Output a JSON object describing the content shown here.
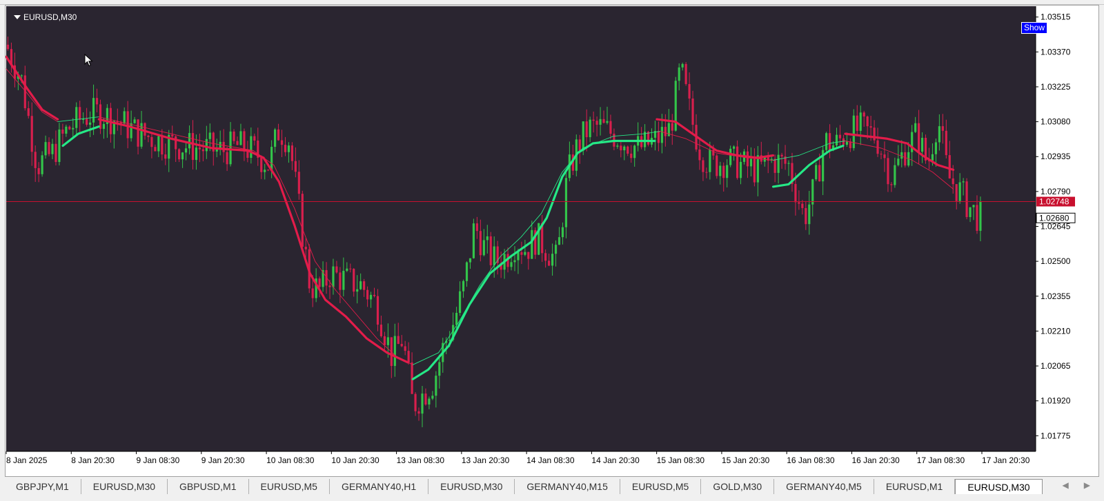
{
  "window": {
    "title": "EURUSD,M30",
    "show_button": "Show"
  },
  "colors": {
    "background": "#2a2530",
    "bull": "#33c44a",
    "bear": "#d81f4d",
    "ma_up": "#25e886",
    "ma_down": "#e31c4a",
    "price_line": "#c8102e",
    "axis_text": "#ffffff",
    "tab_active_bg": "#ffffff"
  },
  "chart_data": {
    "type": "candlestick",
    "symbol": "EURUSD",
    "timeframe": "M30",
    "ylim": [
      1.0171,
      1.0356
    ],
    "y_ticks": [
      "1.03515",
      "1.03370",
      "1.03225",
      "1.03080",
      "1.02935",
      "1.02790",
      "1.02645",
      "1.02500",
      "1.02355",
      "1.02210",
      "1.02065",
      "1.01920",
      "1.01775"
    ],
    "x_ticks": [
      "8 Jan 2025",
      "8 Jan 20:30",
      "9 Jan 08:30",
      "9 Jan 20:30",
      "10 Jan 08:30",
      "10 Jan 20:30",
      "13 Jan 08:30",
      "13 Jan 20:30",
      "14 Jan 08:30",
      "14 Jan 20:30",
      "15 Jan 08:30",
      "15 Jan 20:30",
      "16 Jan 08:30",
      "16 Jan 20:30",
      "17 Jan 08:30",
      "17 Jan 20:30"
    ],
    "current_price": "1.02748",
    "last_price": "1.02680",
    "close_path": [
      [
        0,
        1.034
      ],
      [
        0.015,
        1.0325
      ],
      [
        0.03,
        1.029
      ],
      [
        0.045,
        1.0295
      ],
      [
        0.06,
        1.0305
      ],
      [
        0.075,
        1.031
      ],
      [
        0.09,
        1.0312
      ],
      [
        0.11,
        1.0308
      ],
      [
        0.13,
        1.0303
      ],
      [
        0.15,
        1.03
      ],
      [
        0.17,
        1.0298
      ],
      [
        0.19,
        1.0297
      ],
      [
        0.21,
        1.0296
      ],
      [
        0.225,
        1.0298
      ],
      [
        0.24,
        1.0296
      ],
      [
        0.255,
        1.029
      ],
      [
        0.265,
        1.0305
      ],
      [
        0.275,
        1.03
      ],
      [
        0.285,
        1.027
      ],
      [
        0.295,
        1.024
      ],
      [
        0.305,
        1.0238
      ],
      [
        0.315,
        1.0245
      ],
      [
        0.33,
        1.0242
      ],
      [
        0.345,
        1.024
      ],
      [
        0.36,
        1.0232
      ],
      [
        0.375,
        1.021
      ],
      [
        0.385,
        1.0218
      ],
      [
        0.395,
        1.019
      ],
      [
        0.405,
        1.0195
      ],
      [
        0.415,
        1.02
      ],
      [
        0.425,
        1.0215
      ],
      [
        0.435,
        1.0225
      ],
      [
        0.445,
        1.024
      ],
      [
        0.455,
        1.0265
      ],
      [
        0.465,
        1.0255
      ],
      [
        0.475,
        1.025
      ],
      [
        0.485,
        1.0252
      ],
      [
        0.495,
        1.0258
      ],
      [
        0.505,
        1.0255
      ],
      [
        0.515,
        1.026
      ],
      [
        0.525,
        1.0255
      ],
      [
        0.535,
        1.025
      ],
      [
        0.545,
        1.0285
      ],
      [
        0.555,
        1.0298
      ],
      [
        0.565,
        1.0305
      ],
      [
        0.575,
        1.0306
      ],
      [
        0.585,
        1.0304
      ],
      [
        0.6,
        1.03
      ],
      [
        0.615,
        1.0297
      ],
      [
        0.63,
        1.03
      ],
      [
        0.645,
        1.0305
      ],
      [
        0.655,
        1.033
      ],
      [
        0.665,
        1.031
      ],
      [
        0.675,
        1.0295
      ],
      [
        0.685,
        1.029
      ],
      [
        0.7,
        1.0292
      ],
      [
        0.715,
        1.029
      ],
      [
        0.73,
        1.0288
      ],
      [
        0.745,
        1.0292
      ],
      [
        0.76,
        1.029
      ],
      [
        0.775,
        1.0268
      ],
      [
        0.785,
        1.028
      ],
      [
        0.795,
        1.03
      ],
      [
        0.805,
        1.0298
      ],
      [
        0.815,
        1.0303
      ],
      [
        0.83,
        1.0305
      ],
      [
        0.845,
        1.0302
      ],
      [
        0.86,
        1.0285
      ],
      [
        0.875,
        1.0298
      ],
      [
        0.885,
        1.0303
      ],
      [
        0.895,
        1.029
      ],
      [
        0.905,
        1.031
      ],
      [
        0.915,
        1.0285
      ],
      [
        0.925,
        1.028
      ],
      [
        0.935,
        1.0273
      ],
      [
        0.945,
        1.0268
      ]
    ],
    "ma_fast": [
      {
        "color": "bear",
        "points": [
          [
            0,
            1.0335
          ],
          [
            0.02,
            1.0322
          ],
          [
            0.035,
            1.0313
          ],
          [
            0.05,
            1.0309
          ]
        ]
      },
      {
        "color": "bull",
        "points": [
          [
            0.055,
            1.0298
          ],
          [
            0.07,
            1.0303
          ],
          [
            0.09,
            1.0306
          ]
        ]
      },
      {
        "color": "bear",
        "points": [
          [
            0.09,
            1.0309
          ],
          [
            0.12,
            1.0306
          ],
          [
            0.16,
            1.0301
          ],
          [
            0.2,
            1.0297
          ],
          [
            0.235,
            1.0296
          ],
          [
            0.25,
            1.0293
          ],
          [
            0.265,
            1.0283
          ],
          [
            0.28,
            1.0265
          ],
          [
            0.295,
            1.0245
          ],
          [
            0.31,
            1.0234
          ],
          [
            0.33,
            1.0227
          ],
          [
            0.35,
            1.0218
          ],
          [
            0.37,
            1.0212
          ],
          [
            0.39,
            1.0208
          ]
        ]
      },
      {
        "color": "bull",
        "points": [
          [
            0.395,
            1.0201
          ],
          [
            0.41,
            1.0205
          ],
          [
            0.43,
            1.0215
          ],
          [
            0.45,
            1.0232
          ],
          [
            0.47,
            1.0245
          ],
          [
            0.49,
            1.0252
          ],
          [
            0.51,
            1.0258
          ],
          [
            0.525,
            1.0268
          ],
          [
            0.54,
            1.0285
          ],
          [
            0.555,
            1.0295
          ],
          [
            0.57,
            1.0299
          ],
          [
            0.59,
            1.03
          ],
          [
            0.61,
            1.03
          ],
          [
            0.63,
            1.03
          ]
        ]
      },
      {
        "color": "bear",
        "points": [
          [
            0.632,
            1.0309
          ],
          [
            0.65,
            1.0308
          ],
          [
            0.67,
            1.0302
          ],
          [
            0.69,
            1.0296
          ],
          [
            0.71,
            1.0294
          ],
          [
            0.73,
            1.0293
          ],
          [
            0.745,
            1.0294
          ]
        ]
      },
      {
        "color": "bull",
        "points": [
          [
            0.745,
            1.0281
          ],
          [
            0.76,
            1.0282
          ],
          [
            0.78,
            1.029
          ],
          [
            0.8,
            1.0296
          ],
          [
            0.813,
            1.0298
          ]
        ]
      },
      {
        "color": "bear",
        "points": [
          [
            0.815,
            1.0303
          ],
          [
            0.835,
            1.0302
          ],
          [
            0.855,
            1.0301
          ],
          [
            0.875,
            1.0299
          ],
          [
            0.89,
            1.0294
          ],
          [
            0.905,
            1.029
          ],
          [
            0.92,
            1.0288
          ]
        ]
      }
    ],
    "ma_slow": [
      {
        "color": "bear",
        "points": [
          [
            0,
            1.033
          ],
          [
            0.02,
            1.032
          ],
          [
            0.035,
            1.0312
          ],
          [
            0.05,
            1.0308
          ]
        ]
      },
      {
        "color": "bull",
        "points": [
          [
            0.05,
            1.0308
          ],
          [
            0.07,
            1.0309
          ],
          [
            0.09,
            1.031
          ]
        ]
      },
      {
        "color": "bear",
        "points": [
          [
            0.09,
            1.031
          ],
          [
            0.14,
            1.0305
          ],
          [
            0.2,
            1.0299
          ],
          [
            0.24,
            1.0296
          ],
          [
            0.26,
            1.029
          ],
          [
            0.28,
            1.0272
          ],
          [
            0.3,
            1.025
          ],
          [
            0.32,
            1.0238
          ],
          [
            0.34,
            1.0228
          ],
          [
            0.36,
            1.0218
          ],
          [
            0.38,
            1.021
          ],
          [
            0.395,
            1.0207
          ]
        ]
      },
      {
        "color": "bull",
        "points": [
          [
            0.395,
            1.0207
          ],
          [
            0.42,
            1.0212
          ],
          [
            0.44,
            1.0225
          ],
          [
            0.46,
            1.024
          ],
          [
            0.48,
            1.0252
          ],
          [
            0.5,
            1.026
          ],
          [
            0.52,
            1.027
          ],
          [
            0.54,
            1.0287
          ],
          [
            0.56,
            1.0297
          ],
          [
            0.59,
            1.0302
          ],
          [
            0.62,
            1.0303
          ],
          [
            0.635,
            1.0304
          ]
        ]
      },
      {
        "color": "bear",
        "points": [
          [
            0.635,
            1.0304
          ],
          [
            0.66,
            1.0301
          ],
          [
            0.69,
            1.0295
          ],
          [
            0.72,
            1.0293
          ],
          [
            0.745,
            1.0292
          ]
        ]
      },
      {
        "color": "bull",
        "points": [
          [
            0.745,
            1.0292
          ],
          [
            0.77,
            1.0294
          ],
          [
            0.8,
            1.0299
          ],
          [
            0.815,
            1.03
          ]
        ]
      },
      {
        "color": "bear",
        "points": [
          [
            0.815,
            1.03
          ],
          [
            0.85,
            1.0297
          ],
          [
            0.88,
            1.0292
          ],
          [
            0.9,
            1.0287
          ],
          [
            0.92,
            1.028
          ]
        ]
      }
    ]
  },
  "tabs": [
    {
      "label": "GBPJPY,M1",
      "active": false
    },
    {
      "label": "EURUSD,M30",
      "active": false
    },
    {
      "label": "GBPUSD,M1",
      "active": false
    },
    {
      "label": "EURUSD,M5",
      "active": false
    },
    {
      "label": "GERMANY40,H1",
      "active": false
    },
    {
      "label": "EURUSD,M30",
      "active": false
    },
    {
      "label": "GERMANY40,M15",
      "active": false
    },
    {
      "label": "EURUSD,M5",
      "active": false
    },
    {
      "label": "GOLD,M30",
      "active": false
    },
    {
      "label": "GERMANY40,M5",
      "active": false
    },
    {
      "label": "EURUSD,M1",
      "active": false
    },
    {
      "label": "EURUSD,M30",
      "active": true
    }
  ],
  "tab_scroll": {
    "left": "◀",
    "right": "▶"
  }
}
